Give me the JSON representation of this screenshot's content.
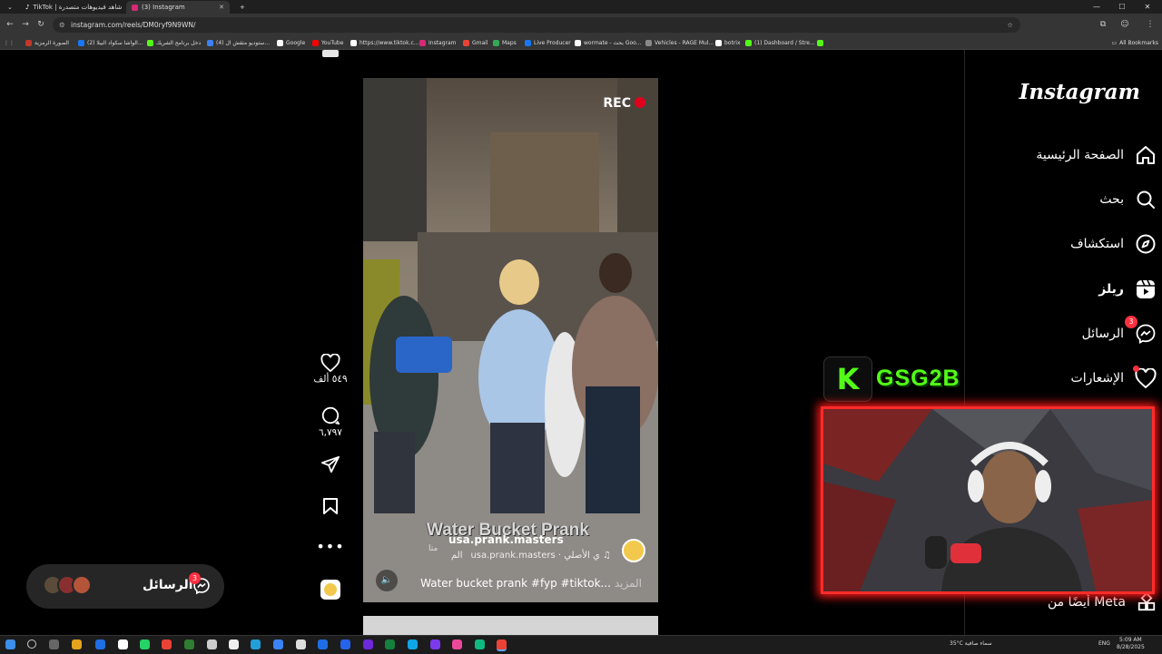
{
  "browser": {
    "tabs": [
      {
        "title": "TikTok | شاهد فيديوهات متصدرة",
        "active": false
      },
      {
        "title": "(3) Instagram",
        "active": true
      }
    ],
    "url": "instagram.com/reels/DM0ryf9N9WN/",
    "bookmarks": [
      {
        "label": "الصورة الرمزية",
        "color": "#c0392b"
      },
      {
        "label": "(2) الواشا سكواد البيلا...",
        "color": "#1877f2"
      },
      {
        "label": "دخل برنامج الشريك",
        "color": "#53fc18"
      },
      {
        "label": "(4) ستوديو مثقش ال...",
        "color": "#3b82f6"
      },
      {
        "label": "Google",
        "color": "#ffffff"
      },
      {
        "label": "YouTube",
        "color": "#ff0000"
      },
      {
        "label": "https://www.tiktok.c...",
        "color": "#ffffff"
      },
      {
        "label": "Instagram",
        "color": "#d62976"
      },
      {
        "label": "Gmail",
        "color": "#ea4335"
      },
      {
        "label": "Maps",
        "color": "#34a853"
      },
      {
        "label": "Live Producer",
        "color": "#1877f2"
      },
      {
        "label": "wormate - بحث Goo...",
        "color": "#ffffff"
      },
      {
        "label": "Vehicles - RAGE Mul...",
        "color": "#888888"
      },
      {
        "label": "botrix",
        "color": "#ffffff"
      },
      {
        "label": "(1) Dashboard / Stre...",
        "color": "#53fc18"
      }
    ],
    "all_bookmarks": "All Bookmarks"
  },
  "instagram": {
    "logo": "Instagram",
    "nav": [
      {
        "label": "الصفحة الرئيسية",
        "icon": "home-icon"
      },
      {
        "label": "بحث",
        "icon": "search-icon"
      },
      {
        "label": "استكشاف",
        "icon": "explore-icon"
      },
      {
        "label": "ريلز",
        "icon": "reels-icon"
      },
      {
        "label": "الرسائل",
        "icon": "messenger-icon",
        "badge": "3"
      },
      {
        "label": "الإشعارات",
        "icon": "heart-icon",
        "dot": true
      }
    ],
    "also_from_meta": "أيضًا من Meta",
    "reel": {
      "rec_text": "REC",
      "overlay_text": "Water Bucket Prank",
      "username": "usa.prank.masters",
      "follow": "متا",
      "audio": "usa.prank.masters · ي الأصلي",
      "audio_prefix": "الم",
      "caption": "Water bucket prank #fyp #tiktok...",
      "more": "المزيد",
      "likes": "٥٤٩ ألف",
      "comments": "٦,٧٩٧"
    },
    "messages_pill": {
      "label": "الرسائل",
      "badge": "3"
    }
  },
  "overlays": {
    "kick_letter": "K",
    "channel_name": "GSG2B"
  },
  "taskbar": {
    "weather": "35°C  سماء صافية",
    "lang": "ENG",
    "time": "5:09 AM",
    "date": "8/28/2025"
  },
  "colors": {
    "badge": "#ff3040",
    "kick_green": "#53fc18",
    "cam_border": "#ff2b2b"
  }
}
